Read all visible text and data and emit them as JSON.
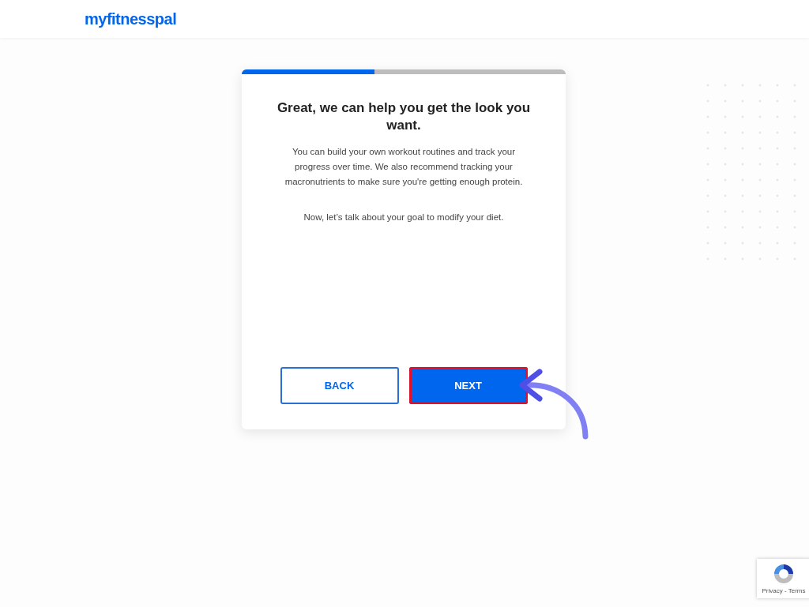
{
  "header": {
    "logo": "myfitnesspal"
  },
  "card": {
    "progress": {
      "level": 0.41
    },
    "title": "Great, we can help you get the look you want.",
    "paragraphs": [
      "You can build your own workout routines and track your progress over time. We also recommend tracking your macronutrients to make sure you're getting enough protein.",
      "Now, let’s talk about your goal to modify your diet."
    ],
    "buttons": [
      {
        "label": "BACK",
        "kind": "outline",
        "highlighted": false
      },
      {
        "label": "NEXT",
        "kind": "primary",
        "highlighted": true
      }
    ]
  },
  "recaptcha": {
    "text": "Privacy - Terms"
  }
}
